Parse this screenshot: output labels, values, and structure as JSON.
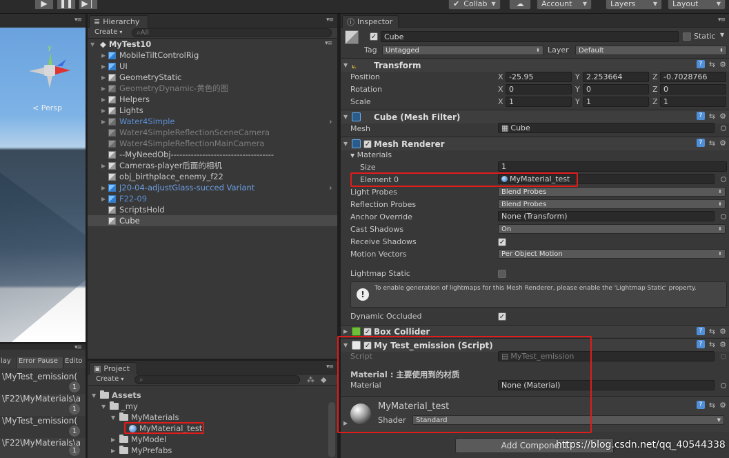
{
  "toolbar": {
    "collab_label": "Collab",
    "account_label": "Account",
    "layers_label": "Layers",
    "layout_label": "Layout"
  },
  "scene": {
    "persp_label": "< Persp",
    "gizmo_y": "y"
  },
  "console": {
    "tabs": [
      "lay",
      "Error Pause",
      "Edito"
    ],
    "rows": [
      {
        "text": "\\MyTest_emission(",
        "count": "1"
      },
      {
        "text": "\\F22\\MyMaterials\\a",
        "count": "1"
      },
      {
        "text": "\\MyTest_emission(",
        "count": "1"
      },
      {
        "text": "\\F22\\MyMaterials\\a",
        "count": "1"
      }
    ]
  },
  "hierarchy": {
    "tab_label": "Hierarchy",
    "create_label": "Create",
    "search_placeholder": "All",
    "scene_name": "MyTest10",
    "items": [
      {
        "label": "MobileTiltControlRig",
        "arrow": true,
        "color": "#c8c8c8",
        "icon": "blue"
      },
      {
        "label": "UI",
        "arrow": true,
        "color": "#c8c8c8",
        "icon": "blue"
      },
      {
        "label": "GeometryStatic",
        "arrow": true,
        "color": "#c8c8c8",
        "icon": "gray"
      },
      {
        "label": "GeometryDynamic-黄色的图",
        "arrow": true,
        "color": "#7e7e7e",
        "icon": "dim"
      },
      {
        "label": "Helpers",
        "arrow": true,
        "color": "#c8c8c8",
        "icon": "gray"
      },
      {
        "label": "Lights",
        "arrow": true,
        "color": "#c8c8c8",
        "icon": "gray"
      },
      {
        "label": "Water4Simple",
        "arrow": true,
        "color": "#5b8fd4",
        "icon": "dim"
      },
      {
        "label": "Water4SimpleReflectionSceneCamera",
        "arrow": false,
        "color": "#7e7e7e",
        "icon": "dim"
      },
      {
        "label": "Water4SimpleReflectionMainCamera",
        "arrow": false,
        "color": "#7e7e7e",
        "icon": "dim"
      },
      {
        "label": "--MyNeedObj------------------------------------",
        "arrow": false,
        "color": "#c8c8c8",
        "icon": "gray"
      },
      {
        "label": "Cameras-player后面的相机",
        "arrow": true,
        "color": "#c8c8c8",
        "icon": "gray"
      },
      {
        "label": "obj_birthplace_enemy_f22",
        "arrow": false,
        "color": "#c8c8c8",
        "icon": "gray"
      },
      {
        "label": "J20-04-adjustGlass-succed Variant",
        "arrow": true,
        "color": "#6d9fe6",
        "icon": "blue"
      },
      {
        "label": "F22-09",
        "arrow": true,
        "color": "#5b8fd4",
        "icon": "blue"
      },
      {
        "label": "ScriptsHold",
        "arrow": false,
        "color": "#c8c8c8",
        "icon": "gray"
      },
      {
        "label": "Cube",
        "arrow": false,
        "color": "#dcdcdc",
        "icon": "gray",
        "selected": true
      }
    ]
  },
  "project": {
    "tab_label": "Project",
    "create_label": "Create",
    "items": [
      {
        "label": "Assets",
        "depth": 0,
        "bold": true
      },
      {
        "label": "_my",
        "depth": 1
      },
      {
        "label": "MyMaterials",
        "depth": 2
      },
      {
        "label": "MyMaterial_test",
        "depth": 3,
        "material": true
      },
      {
        "label": "MyModel",
        "depth": 2
      },
      {
        "label": "MyPrefabs",
        "depth": 2
      }
    ]
  },
  "inspector": {
    "tab_label": "Inspector",
    "object_name": "Cube",
    "static_label": "Static",
    "tag_label": "Tag",
    "tag_value": "Untagged",
    "layer_label": "Layer",
    "layer_value": "Default",
    "transform": {
      "title": "Transform",
      "rows": [
        {
          "label": "Position",
          "x": "-25.95",
          "y": "2.253664",
          "z": "-0.7028766"
        },
        {
          "label": "Rotation",
          "x": "0",
          "y": "0",
          "z": "0"
        },
        {
          "label": "Scale",
          "x": "1",
          "y": "1",
          "z": "1"
        }
      ],
      "axis_x": "X",
      "axis_y": "Y",
      "axis_z": "Z"
    },
    "mesh_filter": {
      "title": "Cube (Mesh Filter)",
      "mesh_label": "Mesh",
      "mesh_value": "Cube"
    },
    "mesh_renderer": {
      "title": "Mesh Renderer",
      "materials_label": "Materials",
      "size_label": "Size",
      "size_value": "1",
      "element_label": "Element 0",
      "element_value": "MyMaterial_test",
      "light_probes_label": "Light Probes",
      "light_probes_value": "Blend Probes",
      "reflection_probes_label": "Reflection Probes",
      "reflection_probes_value": "Blend Probes",
      "anchor_label": "Anchor Override",
      "anchor_value": "None (Transform)",
      "cast_shadows_label": "Cast Shadows",
      "cast_shadows_value": "On",
      "receive_shadows_label": "Receive Shadows",
      "motion_vectors_label": "Motion Vectors",
      "motion_vectors_value": "Per Object Motion",
      "lightmap_static_label": "Lightmap Static",
      "info_text": "To enable generation of lightmaps for this Mesh Renderer, please enable the 'Lightmap Static' property.",
      "dynamic_occluded_label": "Dynamic Occluded"
    },
    "box_collider": {
      "title": "Box Collider"
    },
    "script": {
      "title": "My Test_emission (Script)",
      "script_label": "Script",
      "script_value": "MyTest_emission",
      "header_text": "Material : 主要使用到的材质",
      "material_label": "Material",
      "material_value": "None (Material)"
    },
    "material_preview": {
      "name": "MyMaterial_test",
      "shader_label": "Shader",
      "shader_value": "Standard"
    },
    "add_component_label": "Add Component"
  },
  "watermark": "https://blog.csdn.net/qq_40544338"
}
